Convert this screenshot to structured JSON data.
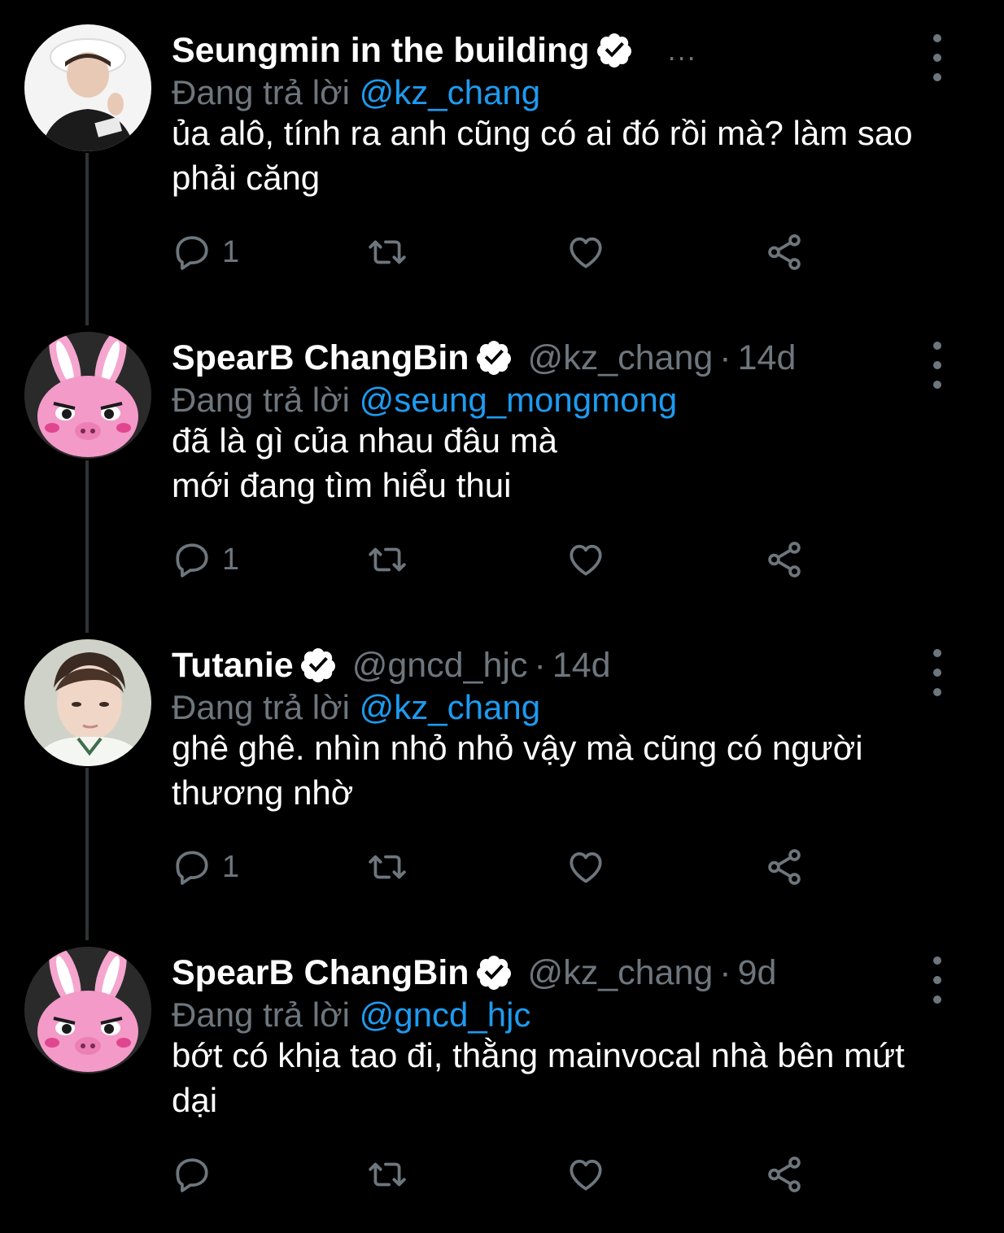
{
  "thread": [
    {
      "name": "Seungmin in the building",
      "verified": true,
      "handle": "",
      "separator": "",
      "time": "",
      "ellipsis": "...",
      "reply_prefix": "Đang trả lời",
      "reply_to": "@kz_chang",
      "text": "ủa alô, tính ra anh cũng có ai đó rồi mà? làm sao phải căng",
      "reply_count": "1",
      "avatar": "seungmin-avatar"
    },
    {
      "name": "SpearB ChangBin",
      "verified": true,
      "handle": "@kz_chang",
      "separator": "·",
      "time": "14d",
      "ellipsis": "",
      "reply_prefix": "Đang trả lời",
      "reply_to": "@seung_mongmong",
      "text": "đã là gì của nhau đâu mà\nmới đang tìm hiểu thui",
      "reply_count": "1",
      "avatar": "pink-bunny-avatar"
    },
    {
      "name": "Tutanie",
      "verified": true,
      "handle": "@gncd_hjc",
      "separator": "·",
      "time": "14d",
      "ellipsis": "",
      "reply_prefix": "Đang trả lời",
      "reply_to": "@kz_chang",
      "text": "ghê ghê. nhìn nhỏ nhỏ vậy mà cũng có người thương nhờ",
      "reply_count": "1",
      "avatar": "tutanie-avatar"
    },
    {
      "name": "SpearB ChangBin",
      "verified": true,
      "handle": "@kz_chang",
      "separator": "·",
      "time": "9d",
      "ellipsis": "",
      "reply_prefix": "Đang trả lời",
      "reply_to": "@gncd_hjc",
      "text": "bớt có khịa tao đi, thằng mainvocal nhà bên mứt dại",
      "reply_count": "",
      "avatar": "pink-bunny-avatar"
    }
  ],
  "colors": {
    "background": "#000000",
    "muted": "#6e767d",
    "mention": "#1d9bf0",
    "thread_line": "#2f3336"
  }
}
